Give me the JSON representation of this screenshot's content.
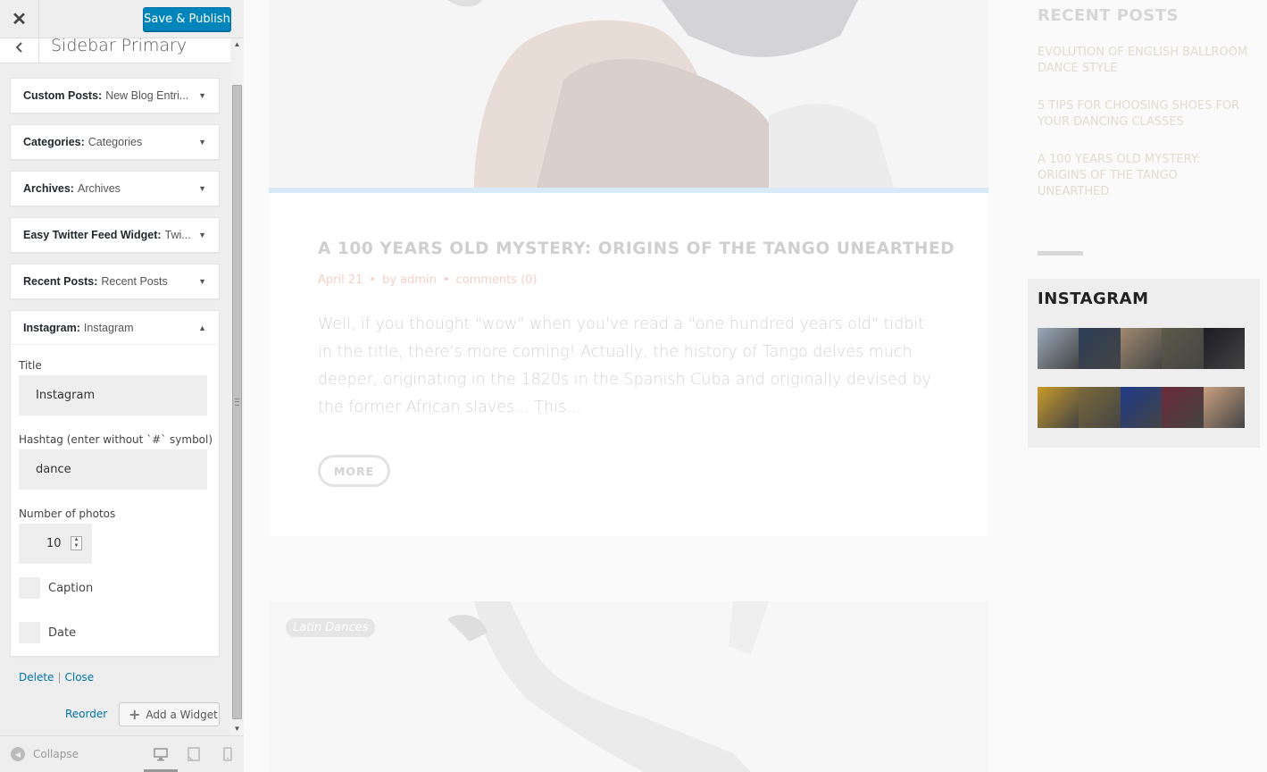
{
  "customizer": {
    "close_label": "✕",
    "save_label": "Save & Publish",
    "section_title": "Sidebar Primary",
    "widgets": [
      {
        "type": "Custom Posts:",
        "title": "New Blog Entri..."
      },
      {
        "type": "Categories:",
        "title": "Categories"
      },
      {
        "type": "Archives:",
        "title": "Archives"
      },
      {
        "type": "Easy Twitter Feed Widget:",
        "title": "Twi..."
      },
      {
        "type": "Recent Posts:",
        "title": "Recent Posts"
      },
      {
        "type": "Instagram:",
        "title": "Instagram"
      }
    ],
    "instagram_form": {
      "title_label": "Title",
      "title_value": "Instagram",
      "hashtag_label": "Hashtag (enter without `#` symbol)",
      "hashtag_value": "dance",
      "photos_label": "Number of photos",
      "photos_value": "10",
      "caption_label": "Caption",
      "date_label": "Date",
      "delete_label": "Delete",
      "separator": "|",
      "close_label": "Close"
    },
    "reorder_label": "Reorder",
    "add_widget_label": "Add a Widget",
    "collapse_label": "Collapse"
  },
  "preview": {
    "post": {
      "title": "A 100 YEARS OLD MYSTERY: ORIGINS OF THE TANGO UNEARTHED",
      "date": "April 21",
      "author": "by admin",
      "comments": "comments (0)",
      "excerpt": "Well, if you thought \"wow\" when you've read a \"one hundred years old\" tidbit in the title, there's more coming! Actually, the history of Tango delves much deeper, originating in the 1820s in the Spanish Cuba and originally devised by the former African slaves... This...",
      "more_label": "MORE"
    },
    "second_post": {
      "category": "Latin Dances"
    },
    "recent_posts": {
      "title": "RECENT POSTS",
      "items": [
        "EVOLUTION OF ENGLISH BALLROOM DANCE STYLE",
        "5 TIPS FOR CHOOSING SHOES FOR YOUR DANCING CLASSES",
        "A 100 YEARS OLD MYSTERY: ORIGINS OF THE TANGO UNEARTHED"
      ]
    },
    "instagram": {
      "title": "INSTAGRAM",
      "photos_row1": [
        "#9aa8b8",
        "#2c3e57",
        "#a08a70",
        "#5c5a48",
        "#1c1c22"
      ],
      "photos_row2": [
        "#c89a2a",
        "#7a6a3a",
        "#1e3a8a",
        "#6b2a3a",
        "#c8a080"
      ]
    }
  }
}
